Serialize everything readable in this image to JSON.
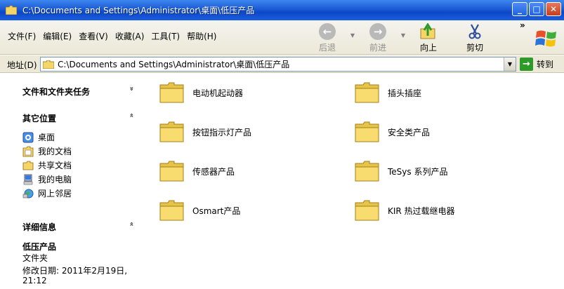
{
  "window": {
    "title": "C:\\Documents and Settings\\Administrator\\桌面\\低压产品",
    "buttons": {
      "minimize": "_",
      "maximize": "□",
      "close": "✕"
    }
  },
  "menu": [
    "文件(F)",
    "编辑(E)",
    "查看(V)",
    "收藏(A)",
    "工具(T)",
    "帮助(H)"
  ],
  "toolbar": {
    "back": "后退",
    "forward": "前进",
    "up": "向上",
    "cut": "剪切",
    "more": "»"
  },
  "address": {
    "label": "地址(D)",
    "value": "C:\\Documents and Settings\\Administrator\\桌面\\低压产品",
    "go": "转到"
  },
  "taskpane": {
    "file_tasks": {
      "title": "文件和文件夹任务",
      "chevron": "»"
    },
    "other_places": {
      "title": "其它位置",
      "chevron": "«",
      "links": [
        "桌面",
        "我的文档",
        "共享文档",
        "我的电脑",
        "网上邻居"
      ]
    },
    "details": {
      "title": "详细信息",
      "chevron": "«",
      "name": "低压产品",
      "type": "文件夹",
      "modified_line1": "修改日期: 2011年2月19日,",
      "modified_line2": "21:12"
    }
  },
  "folders": [
    "电动机起动器",
    "插头插座",
    "按钮指示灯产品",
    "安全类产品",
    "传感器产品",
    "TeSys 系列产品",
    "Osmart产品",
    "KIR 热过载继电器"
  ],
  "colors": {
    "titlebar": "#0c48c8",
    "folder_yellow": "#f7d860",
    "band": "#ece9d8"
  }
}
